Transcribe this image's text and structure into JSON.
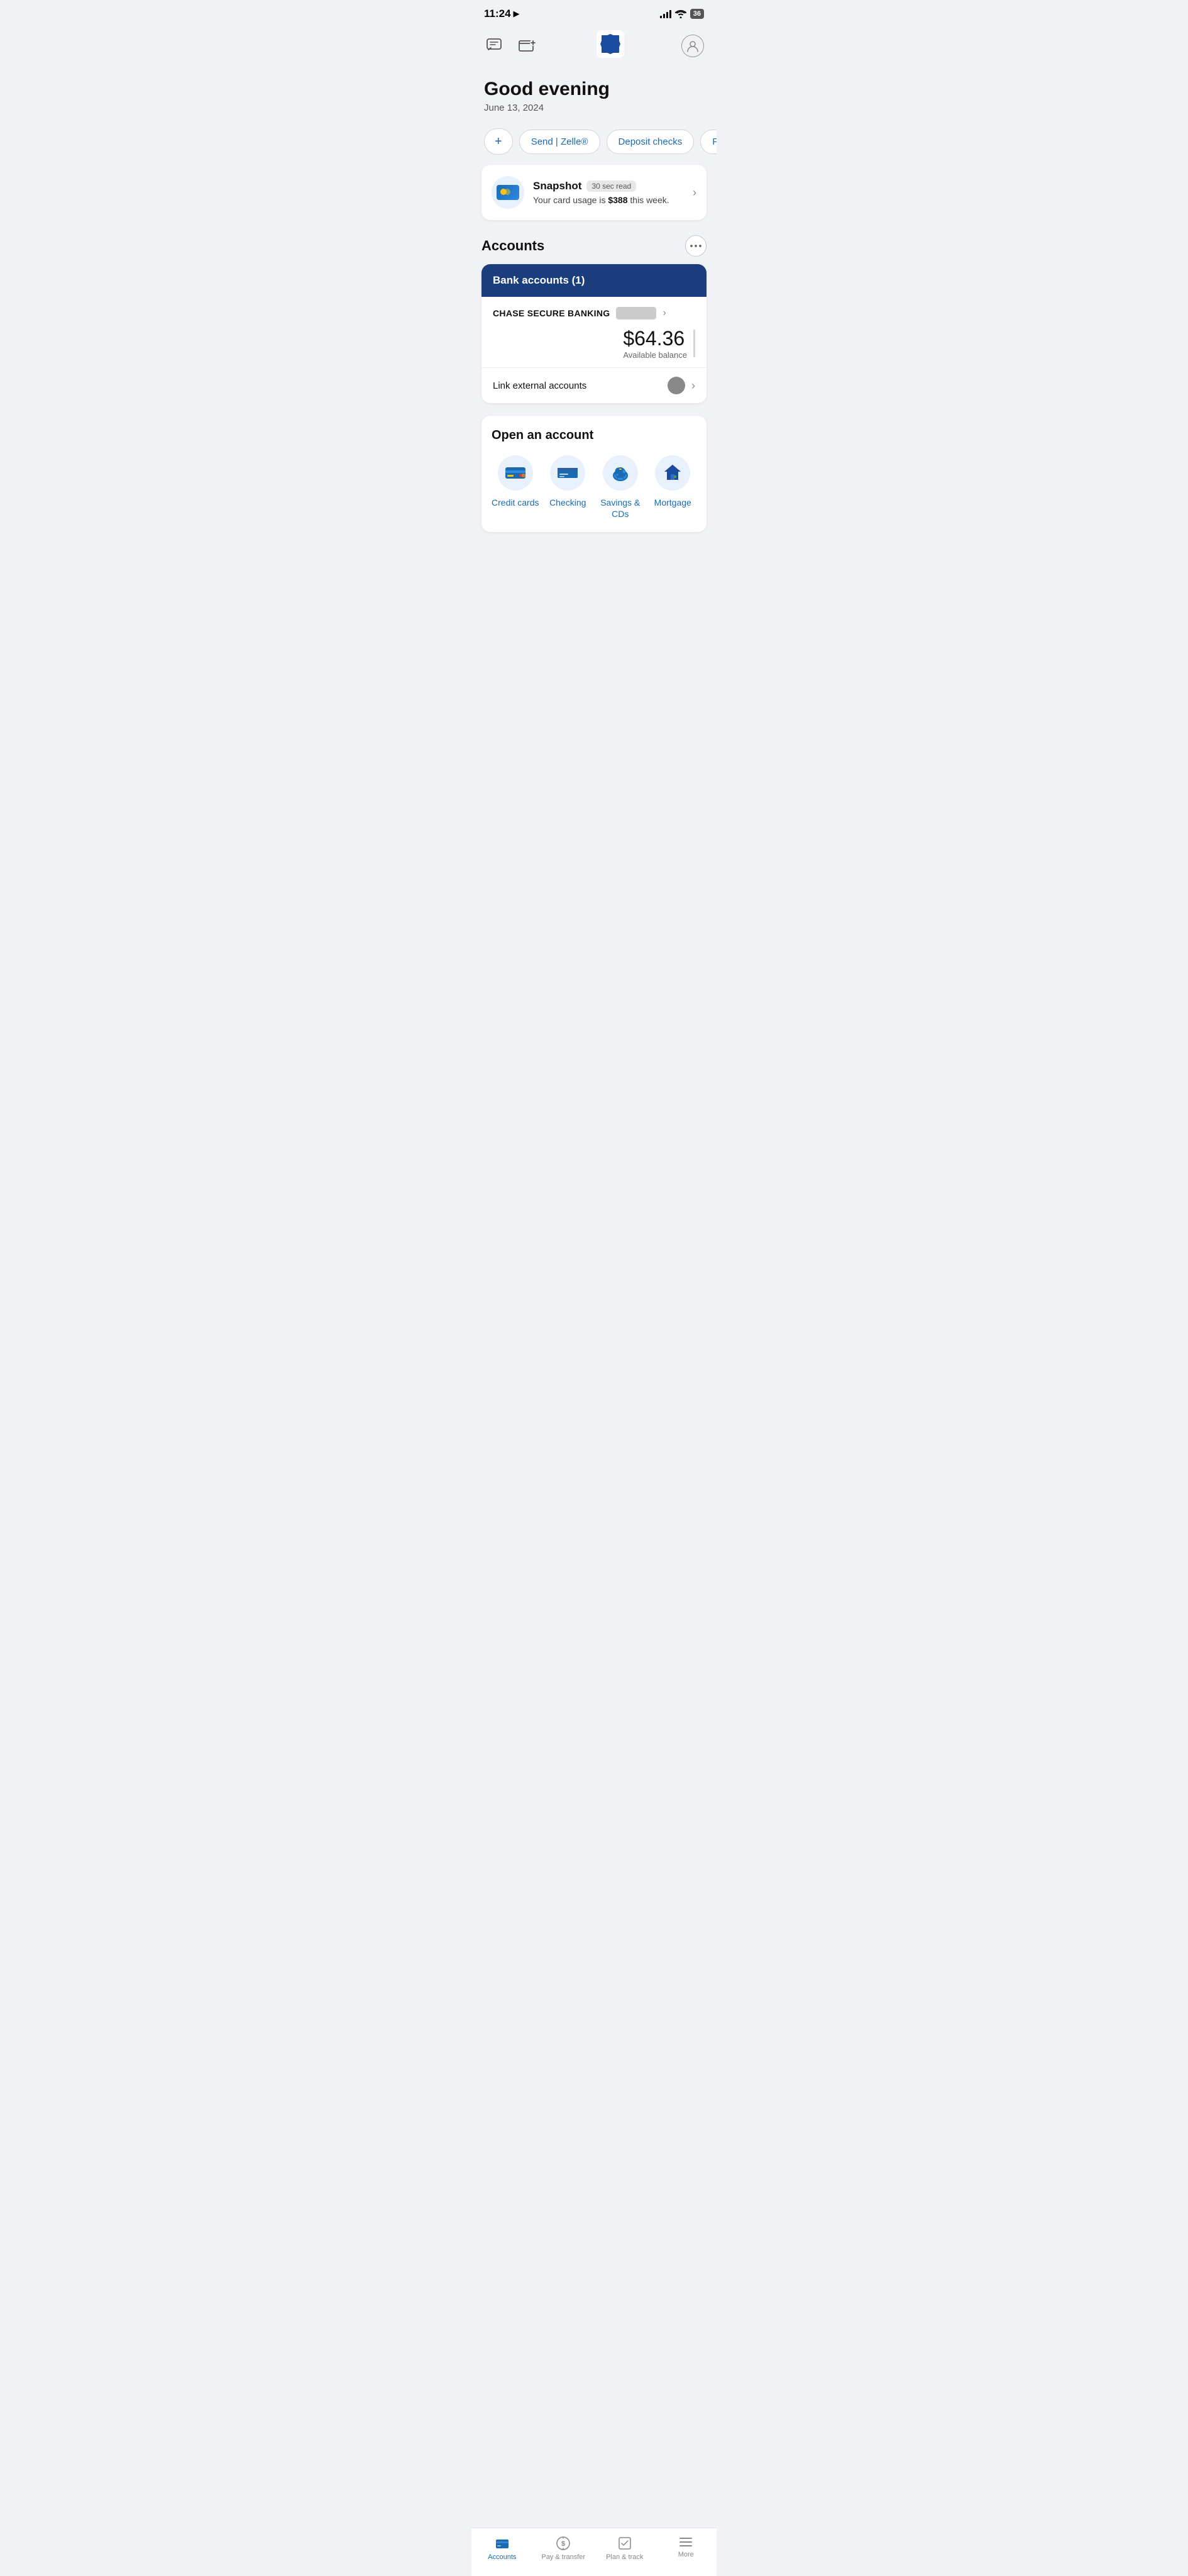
{
  "statusBar": {
    "time": "11:24",
    "battery": "36"
  },
  "greeting": {
    "title": "Good evening",
    "date": "June 13, 2024"
  },
  "quickActions": {
    "plus": "+",
    "send": "Send | Zelle®",
    "deposit": "Deposit checks",
    "pay": "Pay bills"
  },
  "snapshot": {
    "title": "Snapshot",
    "badge": "30 sec read",
    "description": "Your card usage is ",
    "amount": "$388",
    "descSuffix": " this week."
  },
  "accounts": {
    "title": "Accounts",
    "bankSection": {
      "header": "Bank accounts (1)",
      "accountName": "CHASE SECURE BANKING",
      "balance": "$64.36",
      "balanceLabel": "Available balance",
      "linkExternal": "Link external accounts"
    }
  },
  "openAccount": {
    "title": "Open an account",
    "items": [
      {
        "id": "credit-cards",
        "label": "Credit cards",
        "icon": "credit-card-icon"
      },
      {
        "id": "checking",
        "label": "Checking",
        "icon": "checking-icon"
      },
      {
        "id": "savings",
        "label": "Savings & CDs",
        "icon": "savings-icon"
      },
      {
        "id": "mortgage",
        "label": "Mortgage",
        "icon": "mortgage-icon"
      }
    ]
  },
  "bottomNav": {
    "items": [
      {
        "id": "accounts",
        "label": "Accounts",
        "active": true
      },
      {
        "id": "pay-transfer",
        "label": "Pay & transfer",
        "active": false
      },
      {
        "id": "plan-track",
        "label": "Plan & track",
        "active": false
      },
      {
        "id": "more",
        "label": "More",
        "active": false
      }
    ]
  }
}
